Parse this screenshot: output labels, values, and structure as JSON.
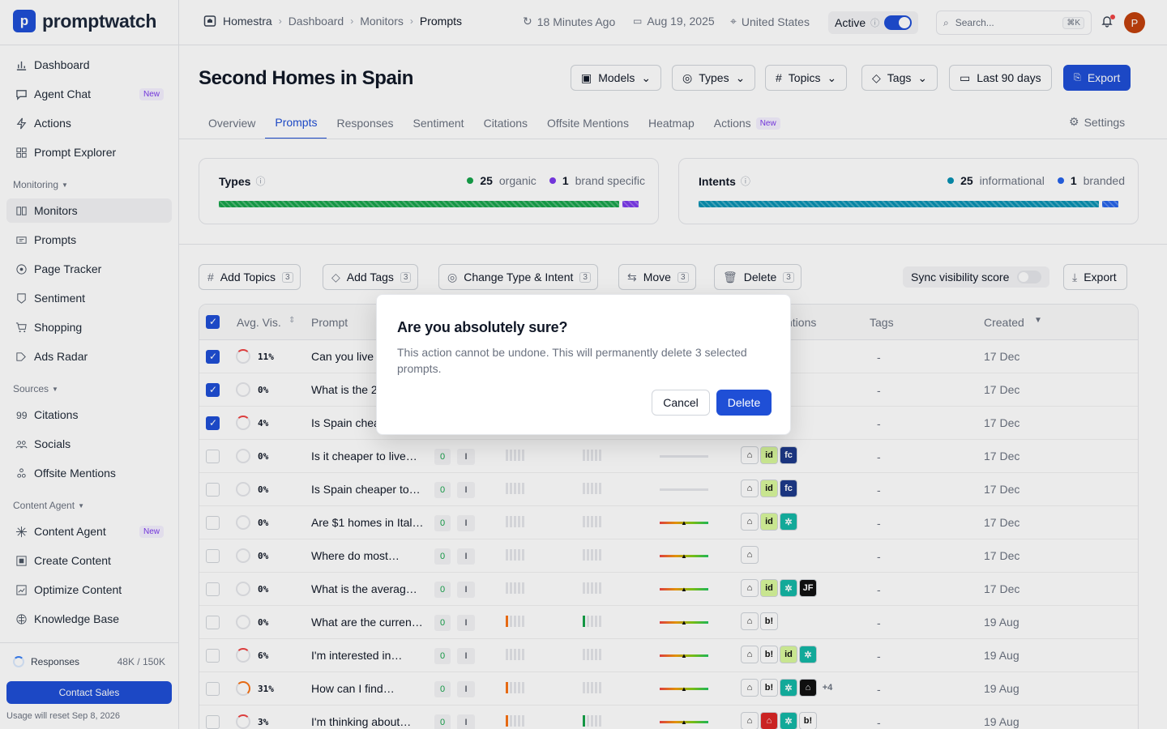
{
  "app": {
    "logo_text": "promptwatch",
    "logo_mark": "p"
  },
  "sidebar": {
    "items": [
      {
        "label": "Dashboard",
        "icon": "bar-chart-icon"
      },
      {
        "label": "Agent Chat",
        "icon": "chat-icon",
        "badge": "New"
      },
      {
        "label": "Actions",
        "icon": "bolt-icon"
      },
      {
        "label": "Prompt Explorer",
        "icon": "grid-icon"
      }
    ],
    "monitoring_label": "Monitoring",
    "monitoring_items": [
      {
        "label": "Monitors",
        "icon": "monitors-icon"
      },
      {
        "label": "Prompts",
        "icon": "prompts-icon"
      },
      {
        "label": "Page Tracker",
        "icon": "page-tracker-icon"
      },
      {
        "label": "Sentiment",
        "icon": "sentiment-icon"
      },
      {
        "label": "Shopping",
        "icon": "cart-icon"
      },
      {
        "label": "Ads Radar",
        "icon": "ads-icon"
      }
    ],
    "sources_label": "Sources",
    "sources_items": [
      {
        "label": "Citations",
        "icon": "quote-icon"
      },
      {
        "label": "Socials",
        "icon": "socials-icon"
      },
      {
        "label": "Offsite Mentions",
        "icon": "offsite-icon"
      }
    ],
    "content_label": "Content Agent",
    "content_items": [
      {
        "label": "Content Agent",
        "icon": "sparkle-icon",
        "badge": "New"
      },
      {
        "label": "Create Content",
        "icon": "create-icon"
      },
      {
        "label": "Optimize Content",
        "icon": "optimize-icon"
      },
      {
        "label": "Knowledge Base",
        "icon": "brain-icon"
      }
    ],
    "usage": {
      "label": "Responses",
      "count": "48K / 150K"
    },
    "contact_label": "Contact Sales",
    "reset_text": "Usage will reset Sep 8, 2026"
  },
  "topbar": {
    "breadcrumb": [
      "Homestra",
      "Dashboard",
      "Monitors",
      "Prompts"
    ],
    "updated": "18 Minutes Ago",
    "date": "Aug 19, 2025",
    "country": "United States",
    "status": "Active",
    "search_placeholder": "Search...",
    "shortcut": "⌘K",
    "avatar_initial": "P"
  },
  "page": {
    "title": "Second Homes in Spain",
    "filters": [
      "Models",
      "Types",
      "Topics",
      "Tags"
    ],
    "date_range": "Last 90 days",
    "export_label": "Export"
  },
  "tabs": [
    "Overview",
    "Prompts",
    "Responses",
    "Sentiment",
    "Citations",
    "Offsite Mentions",
    "Heatmap",
    "Actions"
  ],
  "tab_actions_badge": "New",
  "settings_label": "Settings",
  "types_card": {
    "title": "Types",
    "a_count": "25",
    "a_label": "organic",
    "b_count": "1",
    "b_label": "brand specific",
    "a_value": 25,
    "b_value": 1,
    "a_color": "#16a34a",
    "b_color": "#7c3aed"
  },
  "intents_card": {
    "title": "Intents",
    "a_count": "25",
    "a_label": "informational",
    "b_count": "1",
    "b_label": "branded",
    "a_value": 25,
    "b_value": 1,
    "a_color": "#0891b2",
    "b_color": "#2563eb"
  },
  "actions": {
    "add_topics": "Add Topics",
    "add_tags": "Add Tags",
    "change_type": "Change Type & Intent",
    "move": "Move",
    "delete": "Delete",
    "selected_count": "3",
    "sync_label": "Sync visibility score",
    "export": "Export"
  },
  "table": {
    "headers": {
      "vis": "Avg. Vis.",
      "prompt": "Prompt",
      "mentions": "ntions",
      "tags": "Tags",
      "created": "Created"
    },
    "rows": [
      {
        "checked": true,
        "vis": "11%",
        "vis_pct": 11,
        "prompt": "Can you live",
        "created": "17 Dec",
        "tags": "-"
      },
      {
        "checked": true,
        "vis": "0%",
        "vis_pct": 0,
        "prompt": "What is the 2",
        "created": "17 Dec",
        "tags": "-"
      },
      {
        "checked": true,
        "vis": "4%",
        "vis_pct": 4,
        "prompt": "Is Spain chea",
        "created": "17 Dec",
        "tags": "-"
      },
      {
        "checked": false,
        "vis": "0%",
        "vis_pct": 0,
        "prompt": "Is it cheaper to live…",
        "created": "17 Dec",
        "tags": "-"
      },
      {
        "checked": false,
        "vis": "0%",
        "vis_pct": 0,
        "prompt": "Is Spain cheaper to…",
        "created": "17 Dec",
        "tags": "-"
      },
      {
        "checked": false,
        "vis": "0%",
        "vis_pct": 0,
        "prompt": "Are $1 homes in Ital…",
        "created": "17 Dec",
        "tags": "-"
      },
      {
        "checked": false,
        "vis": "0%",
        "vis_pct": 0,
        "prompt": "Where do most…",
        "created": "17 Dec",
        "tags": "-"
      },
      {
        "checked": false,
        "vis": "0%",
        "vis_pct": 0,
        "prompt": "What is the averag…",
        "created": "17 Dec",
        "tags": "-"
      },
      {
        "checked": false,
        "vis": "0%",
        "vis_pct": 0,
        "prompt": "What are the curren…",
        "created": "19 Aug",
        "tags": "-"
      },
      {
        "checked": false,
        "vis": "6%",
        "vis_pct": 6,
        "prompt": "I'm interested in…",
        "created": "19 Aug",
        "tags": "-"
      },
      {
        "checked": false,
        "vis": "31%",
        "vis_pct": 31,
        "prompt": "How can I find…",
        "created": "19 Aug",
        "tags": "-"
      },
      {
        "checked": false,
        "vis": "3%",
        "vis_pct": 3,
        "prompt": "I'm thinking about…",
        "created": "19 Aug",
        "tags": "-"
      }
    ],
    "count_zero": "0",
    "intent_letter": "I",
    "more_label": "+4"
  },
  "dialog": {
    "title": "Are you absolutely sure?",
    "body": "This action cannot be undone. This will permanently delete 3 selected prompts.",
    "cancel": "Cancel",
    "confirm": "Delete"
  }
}
